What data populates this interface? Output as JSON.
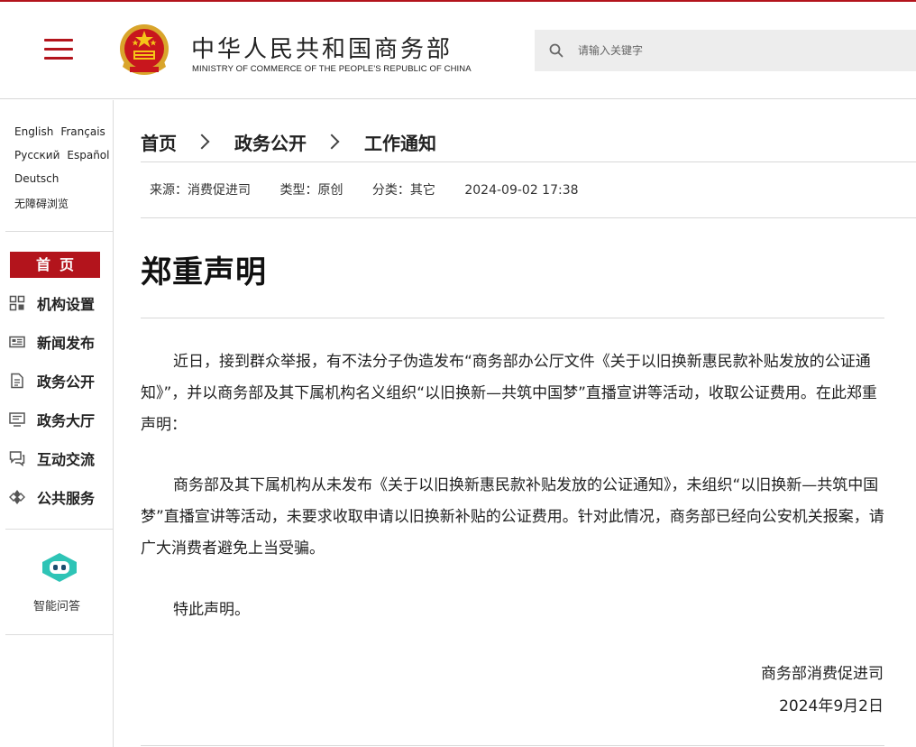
{
  "header": {
    "title": "中华人民共和国商务部",
    "subtitle": "MINISTRY OF COMMERCE OF THE PEOPLE'S REPUBLIC OF CHINA",
    "search_placeholder": "请输入关键字"
  },
  "sidebar": {
    "languages_row1": [
      "English",
      "Français"
    ],
    "languages_row2": [
      "Русский",
      "Español"
    ],
    "languages_row3": [
      "Deutsch"
    ],
    "accessibility": "无障碍浏览",
    "home": "首页",
    "items": [
      {
        "label": "机构设置",
        "icon": "org-structure-icon"
      },
      {
        "label": "新闻发布",
        "icon": "news-icon"
      },
      {
        "label": "政务公开",
        "icon": "document-icon"
      },
      {
        "label": "政务大厅",
        "icon": "service-hall-icon"
      },
      {
        "label": "互动交流",
        "icon": "chat-icon"
      },
      {
        "label": "公共服务",
        "icon": "public-service-icon"
      }
    ],
    "assistant_label": "智能问答"
  },
  "breadcrumb": [
    "首页",
    "政务公开",
    "工作通知"
  ],
  "meta": {
    "source": "来源：消费促进司",
    "type": "类型：原创",
    "category": "分类：其它",
    "datetime": "2024-09-02 17:38"
  },
  "article": {
    "title": "郑重声明",
    "paragraphs": [
      "近日，接到群众举报，有不法分子伪造发布“商务部办公厅文件《关于以旧换新惠民款补贴发放的公证通知》”，并以商务部及其下属机构名义组织“以旧换新—共筑中国梦”直播宣讲等活动，收取公证费用。在此郑重声明：",
      "商务部及其下属机构从未发布《关于以旧换新惠民款补贴发放的公证通知》，未组织“以旧换新—共筑中国梦”直播宣讲等活动，未要求收取申请以旧换新补贴的公证费用。针对此情况，商务部已经向公安机关报案，请广大消费者避免上当受骗。",
      "特此声明。"
    ],
    "signature": "商务部消费促进司",
    "date": "2024年9月2日"
  },
  "colors": {
    "accent": "#b3141c",
    "assistant": "#2ec4b6"
  }
}
